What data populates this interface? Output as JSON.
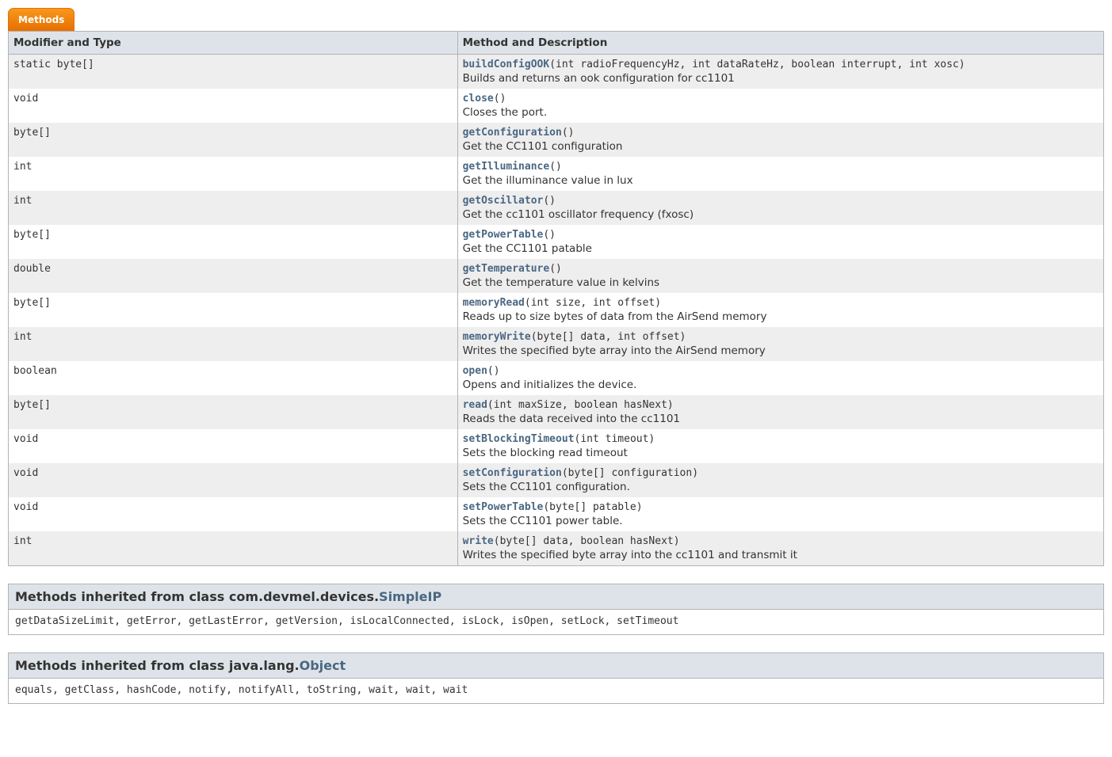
{
  "tab_label": "Methods",
  "headers": {
    "col1": "Modifier and Type",
    "col2": "Method and Description"
  },
  "methods": [
    {
      "modifier": "static byte[]",
      "name": "buildConfigOOK",
      "params": "(int radioFrequencyHz, int dataRateHz, boolean interrupt, int xosc)",
      "desc": "Builds and returns an ook configuration for cc1101"
    },
    {
      "modifier": "void",
      "name": "close",
      "params": "()",
      "desc": "Closes the port."
    },
    {
      "modifier": "byte[]",
      "name": "getConfiguration",
      "params": "()",
      "desc": "Get the CC1101 configuration"
    },
    {
      "modifier": "int",
      "name": "getIlluminance",
      "params": "()",
      "desc": "Get the illuminance value in lux"
    },
    {
      "modifier": "int",
      "name": "getOscillator",
      "params": "()",
      "desc": "Get the cc1101 oscillator frequency (fxosc)"
    },
    {
      "modifier": "byte[]",
      "name": "getPowerTable",
      "params": "()",
      "desc": "Get the CC1101 patable"
    },
    {
      "modifier": "double",
      "name": "getTemperature",
      "params": "()",
      "desc": "Get the temperature value in kelvins"
    },
    {
      "modifier": "byte[]",
      "name": "memoryRead",
      "params": "(int size, int offset)",
      "desc": "Reads up to size bytes of data from the AirSend memory"
    },
    {
      "modifier": "int",
      "name": "memoryWrite",
      "params": "(byte[] data, int offset)",
      "desc": "Writes the specified byte array into the AirSend memory"
    },
    {
      "modifier": "boolean",
      "name": "open",
      "params": "()",
      "desc": "Opens and initializes the device."
    },
    {
      "modifier": "byte[]",
      "name": "read",
      "params": "(int maxSize, boolean hasNext)",
      "desc": "Reads the data received into the cc1101"
    },
    {
      "modifier": "void",
      "name": "setBlockingTimeout",
      "params": "(int timeout)",
      "desc": "Sets the blocking read timeout"
    },
    {
      "modifier": "void",
      "name": "setConfiguration",
      "params": "(byte[] configuration)",
      "desc": "Sets the CC1101 configuration."
    },
    {
      "modifier": "void",
      "name": "setPowerTable",
      "params": "(byte[] patable)",
      "desc": "Sets the CC1101 power table."
    },
    {
      "modifier": "int",
      "name": "write",
      "params": "(byte[] data, boolean hasNext)",
      "desc": "Writes the specified byte array into the cc1101 and transmit it"
    }
  ],
  "inherited": [
    {
      "heading_prefix": "Methods inherited from class com.devmel.devices.",
      "class_link": "SimpleIP",
      "list": "getDataSizeLimit, getError, getLastError, getVersion, isLocalConnected, isLock, isOpen, setLock, setTimeout"
    },
    {
      "heading_prefix": "Methods inherited from class java.lang.",
      "class_link": "Object",
      "list": "equals, getClass, hashCode, notify, notifyAll, toString, wait, wait, wait"
    }
  ]
}
